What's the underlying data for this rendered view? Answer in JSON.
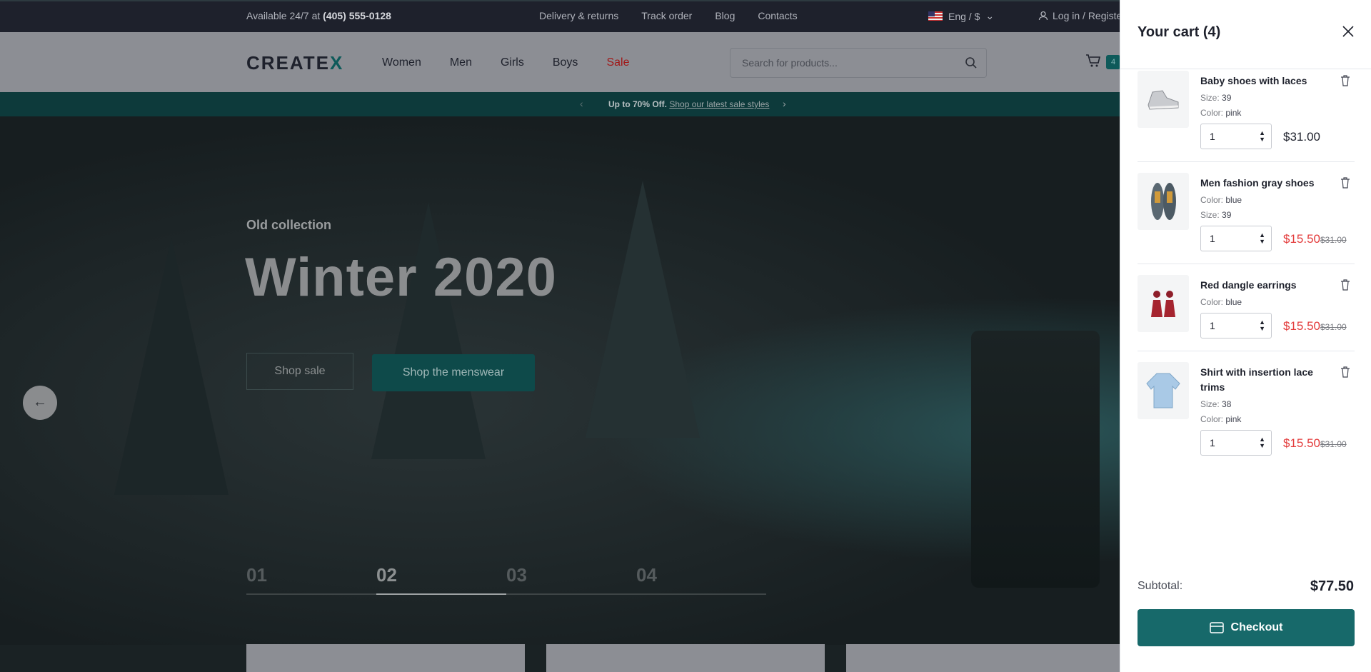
{
  "topbar": {
    "availability_label": "Available 24/7 at",
    "phone": "(405) 555-0128",
    "links": [
      "Delivery & returns",
      "Track order",
      "Blog",
      "Contacts"
    ],
    "language": "Eng / $",
    "login": "Log in / Register"
  },
  "header": {
    "logo_main": "CREATE",
    "logo_accent": "X",
    "nav": [
      "Women",
      "Men",
      "Girls",
      "Boys",
      "Sale"
    ],
    "search_placeholder": "Search for products...",
    "cart_count": "4"
  },
  "promo": {
    "bold": "Up to 70% Off.",
    "link": "Shop our latest sale styles"
  },
  "hero": {
    "eyebrow": "Old collection",
    "title": "Winter 2020",
    "btn_sale": "Shop sale",
    "btn_men": "Shop the menswear",
    "slides": [
      "01",
      "02",
      "03",
      "04"
    ],
    "active_slide": "02"
  },
  "cart": {
    "title": "Your cart (4)",
    "items": [
      {
        "name": "Baby shoes with laces",
        "attr1_label": "Size:",
        "attr1_value": "39",
        "attr2_label": "Color:",
        "attr2_value": "pink",
        "qty": "1",
        "price": "$31.00",
        "old_price": ""
      },
      {
        "name": "Men fashion gray shoes",
        "attr1_label": "Color:",
        "attr1_value": "blue",
        "attr2_label": "Size:",
        "attr2_value": "39",
        "qty": "1",
        "price": "$15.50",
        "old_price": "$31.00"
      },
      {
        "name": "Red dangle earrings",
        "attr1_label": "Color:",
        "attr1_value": "blue",
        "qty": "1",
        "price": "$15.50",
        "old_price": "$31.00"
      },
      {
        "name": "Shirt with insertion lace trims",
        "attr1_label": "Size:",
        "attr1_value": "38",
        "attr2_label": "Color:",
        "attr2_value": "pink",
        "qty": "1",
        "price": "$15.50",
        "old_price": "$31.00"
      }
    ],
    "subtotal_label": "Subtotal:",
    "subtotal_value": "$77.50",
    "checkout": "Checkout"
  },
  "colors": {
    "accent": "#17696a",
    "sale": "#e33b3b",
    "dark": "#1e212c"
  }
}
